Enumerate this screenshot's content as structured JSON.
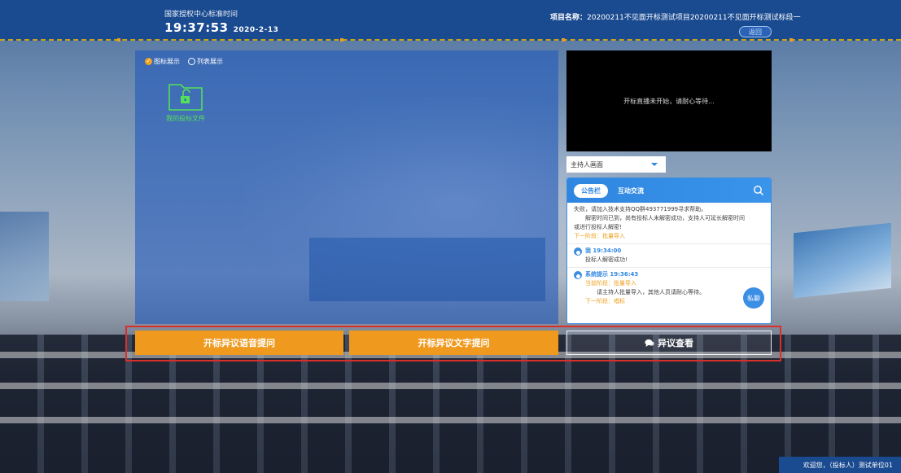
{
  "header": {
    "clock_label": "国家授权中心标准时间",
    "time": "19:37:53",
    "date": "2020-2-13",
    "project_label": "项目名称：",
    "project_name": "20200211不见面开标测试项目20200211不见面开标测试标段一",
    "back_label": "返回"
  },
  "left_panel": {
    "view_icon": "图标展示",
    "view_list": "列表展示",
    "selected_view": "图标展示",
    "folder_label": "我的投标文件",
    "folder_icon": "unlocked-folder-icon",
    "folder_color": "#54e05a"
  },
  "video": {
    "status": "开标直播未开始，请耐心等待..."
  },
  "host_select": {
    "value": "主持人画面"
  },
  "chat": {
    "tab_notice": "公告栏",
    "tab_interact": "互动交流",
    "active_tab": "公告栏",
    "messages": [
      {
        "line1": "失败，请加入技术支持QQ群493771999寻求帮助。",
        "line2": "解密时间已到，尚有投标人未解密成功，支持人可延长解密时间",
        "line3": "或进行投标人解密!",
        "next_stage": "下一阶段：批量导入"
      },
      {
        "sender": "我 19:34:00",
        "text": "投标人解密成功!"
      },
      {
        "sender": "系统提示 19:36:43",
        "current_stage": "当前阶段：批量导入",
        "text": "请主持人批量导入，其他人员请耐心等待。",
        "next_stage": "下一阶段：唱标"
      }
    ],
    "private_label": "私聊"
  },
  "actions": {
    "voice_label": "开标异议语音提问",
    "text_label": "开标异议文字提问",
    "view_label": "异议查看",
    "accent": "#ef9a1f",
    "highlight": "#d9302c"
  },
  "footer": {
    "welcome": "欢迎您，（投标人）测试单位01"
  }
}
